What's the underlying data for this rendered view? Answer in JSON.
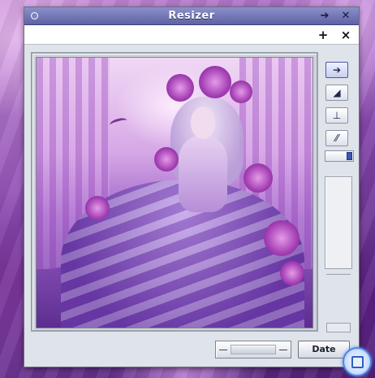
{
  "window": {
    "title": "Resizer",
    "titlebar_buttons": {
      "pin_icon": "arrow-right-icon",
      "pin_glyph": "➔",
      "close_glyph": "✕"
    }
  },
  "menubar": {
    "add_glyph": "+",
    "close_glyph": "×"
  },
  "tools": [
    {
      "name": "arrow-right-icon",
      "glyph": "➔"
    },
    {
      "name": "corner-resize-icon",
      "glyph": "◢"
    },
    {
      "name": "anchor-icon",
      "glyph": "⊥"
    },
    {
      "name": "slash-icon",
      "glyph": "⁄⁄"
    }
  ],
  "footer": {
    "date_label": "Date"
  },
  "image": {
    "icon": "image-preview"
  },
  "colors": {
    "titlebar": "#6b6fb3",
    "window_bg": "#dfe3ea",
    "accent": "#3c57b3"
  }
}
